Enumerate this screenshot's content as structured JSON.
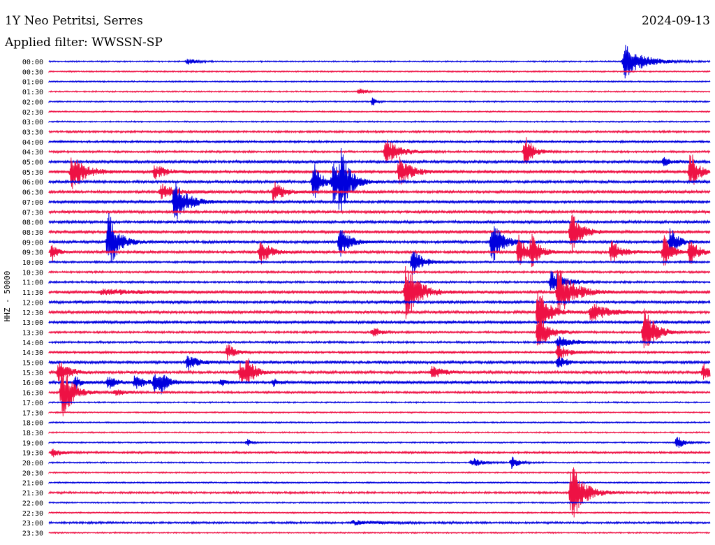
{
  "header": {
    "station": "1Y Neo Petritsi, Serres",
    "date": "2024-09-13",
    "filter": "Applied filter: WWSSN-SP"
  },
  "chart_data": {
    "type": "line",
    "title": "1Y Neo Petritsi, Serres",
    "ylabel": "HHZ - 50000",
    "colors": [
      "#0000dd",
      "#ee1144"
    ],
    "time_labels": [
      "00:00",
      "00:30",
      "01:00",
      "01:30",
      "02:00",
      "02:30",
      "03:00",
      "03:30",
      "04:00",
      "04:30",
      "05:00",
      "05:30",
      "06:00",
      "06:30",
      "07:00",
      "07:30",
      "08:00",
      "08:30",
      "09:00",
      "09:30",
      "10:00",
      "10:30",
      "11:00",
      "11:30",
      "12:00",
      "12:30",
      "13:00",
      "13:30",
      "14:00",
      "14:30",
      "15:00",
      "15:30",
      "16:00",
      "16:30",
      "17:00",
      "17:30",
      "18:00",
      "18:30",
      "19:00",
      "19:30",
      "20:00",
      "20:30",
      "21:00",
      "21:30",
      "22:00",
      "22:30",
      "23:00",
      "23:30"
    ],
    "noise": [
      1,
      1,
      1,
      1,
      1,
      1,
      1,
      1.5,
      1.5,
      1.5,
      2,
      2,
      2,
      2,
      2,
      2,
      2,
      2,
      2,
      2,
      1.5,
      1.5,
      1.5,
      2,
      2,
      2,
      2,
      1.5,
      1.5,
      1.5,
      2,
      2,
      2,
      1.5,
      1,
      1,
      1,
      1,
      1,
      1.5,
      1,
      1,
      1,
      1.5,
      1,
      1,
      1.5,
      1
    ],
    "events": [
      {
        "row": 0,
        "t": 0.21,
        "a": 4,
        "d": 0.04
      },
      {
        "row": 0,
        "t": 0.87,
        "a": 28,
        "d": 0.07
      },
      {
        "row": 3,
        "t": 0.47,
        "a": 6,
        "d": 0.02
      },
      {
        "row": 4,
        "t": 0.49,
        "a": 7,
        "d": 0.015
      },
      {
        "row": 9,
        "t": 0.51,
        "a": 22,
        "d": 0.05
      },
      {
        "row": 9,
        "t": 0.72,
        "a": 26,
        "d": 0.03
      },
      {
        "row": 10,
        "t": 0.93,
        "a": 6,
        "d": 0.03
      },
      {
        "row": 11,
        "t": 0.035,
        "a": 32,
        "d": 0.05
      },
      {
        "row": 11,
        "t": 0.16,
        "a": 10,
        "d": 0.05
      },
      {
        "row": 11,
        "t": 0.53,
        "a": 22,
        "d": 0.05
      },
      {
        "row": 11,
        "t": 0.97,
        "a": 34,
        "d": 0.03
      },
      {
        "row": 12,
        "t": 0.4,
        "a": 30,
        "d": 0.03
      },
      {
        "row": 12,
        "t": 0.43,
        "a": 30,
        "d": 0.03
      },
      {
        "row": 12,
        "t": 0.44,
        "a": 44,
        "d": 0.04
      },
      {
        "row": 13,
        "t": 0.17,
        "a": 12,
        "d": 0.06
      },
      {
        "row": 13,
        "t": 0.34,
        "a": 16,
        "d": 0.04
      },
      {
        "row": 14,
        "t": 0.19,
        "a": 34,
        "d": 0.05
      },
      {
        "row": 17,
        "t": 0.79,
        "a": 30,
        "d": 0.04
      },
      {
        "row": 18,
        "t": 0.09,
        "a": 44,
        "d": 0.04
      },
      {
        "row": 18,
        "t": 0.44,
        "a": 22,
        "d": 0.04
      },
      {
        "row": 18,
        "t": 0.67,
        "a": 34,
        "d": 0.04
      },
      {
        "row": 18,
        "t": 0.94,
        "a": 22,
        "d": 0.03
      },
      {
        "row": 19,
        "t": 0.005,
        "a": 14,
        "d": 0.02
      },
      {
        "row": 19,
        "t": 0.32,
        "a": 18,
        "d": 0.04
      },
      {
        "row": 19,
        "t": 0.71,
        "a": 26,
        "d": 0.03
      },
      {
        "row": 19,
        "t": 0.73,
        "a": 26,
        "d": 0.03
      },
      {
        "row": 19,
        "t": 0.85,
        "a": 18,
        "d": 0.04
      },
      {
        "row": 19,
        "t": 0.93,
        "a": 24,
        "d": 0.03
      },
      {
        "row": 19,
        "t": 0.97,
        "a": 22,
        "d": 0.03
      },
      {
        "row": 20,
        "t": 0.55,
        "a": 22,
        "d": 0.04
      },
      {
        "row": 22,
        "t": 0.76,
        "a": 20,
        "d": 0.05
      },
      {
        "row": 23,
        "t": 0.54,
        "a": 46,
        "d": 0.05
      },
      {
        "row": 23,
        "t": 0.77,
        "a": 38,
        "d": 0.06
      },
      {
        "row": 23,
        "t": 0.08,
        "a": 4,
        "d": 0.15
      },
      {
        "row": 25,
        "t": 0.74,
        "a": 38,
        "d": 0.04
      },
      {
        "row": 25,
        "t": 0.82,
        "a": 16,
        "d": 0.06
      },
      {
        "row": 27,
        "t": 0.49,
        "a": 8,
        "d": 0.03
      },
      {
        "row": 27,
        "t": 0.9,
        "a": 42,
        "d": 0.04
      },
      {
        "row": 27,
        "t": 0.74,
        "a": 30,
        "d": 0.04
      },
      {
        "row": 28,
        "t": 0.77,
        "a": 10,
        "d": 0.05
      },
      {
        "row": 29,
        "t": 0.27,
        "a": 12,
        "d": 0.03
      },
      {
        "row": 29,
        "t": 0.77,
        "a": 12,
        "d": 0.04
      },
      {
        "row": 30,
        "t": 0.21,
        "a": 12,
        "d": 0.04
      },
      {
        "row": 30,
        "t": 0.77,
        "a": 10,
        "d": 0.03
      },
      {
        "row": 31,
        "t": 0.015,
        "a": 18,
        "d": 0.04
      },
      {
        "row": 31,
        "t": 0.29,
        "a": 16,
        "d": 0.03
      },
      {
        "row": 31,
        "t": 0.3,
        "a": 18,
        "d": 0.03
      },
      {
        "row": 31,
        "t": 0.58,
        "a": 10,
        "d": 0.04
      },
      {
        "row": 31,
        "t": 0.99,
        "a": 12,
        "d": 0.03
      },
      {
        "row": 32,
        "t": 0.04,
        "a": 12,
        "d": 0.02
      },
      {
        "row": 32,
        "t": 0.09,
        "a": 10,
        "d": 0.03
      },
      {
        "row": 32,
        "t": 0.13,
        "a": 10,
        "d": 0.04
      },
      {
        "row": 32,
        "t": 0.16,
        "a": 12,
        "d": 0.03
      },
      {
        "row": 32,
        "t": 0.17,
        "a": 12,
        "d": 0.03
      },
      {
        "row": 32,
        "t": 0.26,
        "a": 6,
        "d": 0.02
      },
      {
        "row": 32,
        "t": 0.34,
        "a": 6,
        "d": 0.02
      },
      {
        "row": 33,
        "t": 0.02,
        "a": 44,
        "d": 0.04
      },
      {
        "row": 33,
        "t": 0.1,
        "a": 5,
        "d": 0.04
      },
      {
        "row": 38,
        "t": 0.3,
        "a": 5,
        "d": 0.02
      },
      {
        "row": 38,
        "t": 0.95,
        "a": 10,
        "d": 0.03
      },
      {
        "row": 39,
        "t": 0.006,
        "a": 8,
        "d": 0.03
      },
      {
        "row": 40,
        "t": 0.64,
        "a": 7,
        "d": 0.04
      },
      {
        "row": 40,
        "t": 0.7,
        "a": 9,
        "d": 0.03
      },
      {
        "row": 43,
        "t": 0.79,
        "a": 44,
        "d": 0.05
      },
      {
        "row": 46,
        "t": 0.46,
        "a": 3,
        "d": 0.12
      }
    ]
  }
}
